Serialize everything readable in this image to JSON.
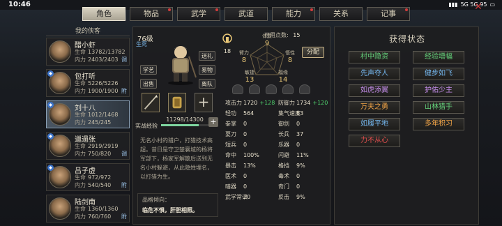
{
  "status_bar": {
    "time": "10:46",
    "indicators": "5G 5G 95"
  },
  "tabs": [
    {
      "label": "角色",
      "active": true,
      "dot": false
    },
    {
      "label": "物品",
      "active": false,
      "dot": true
    },
    {
      "label": "武学",
      "active": false,
      "dot": true
    },
    {
      "label": "武道",
      "active": false,
      "dot": false
    },
    {
      "label": "能力",
      "active": false,
      "dot": true
    },
    {
      "label": "关系",
      "active": false,
      "dot": false
    },
    {
      "label": "记事",
      "active": false,
      "dot": true
    }
  ],
  "left": {
    "header": "我的侠客",
    "characters": [
      {
        "name": "醋小虾",
        "hp": "13782/13782",
        "mp": "2403/2403",
        "tag": "调",
        "selected": false,
        "badge": false
      },
      {
        "name": "包打听",
        "hp": "5226/5226",
        "mp": "1900/1900",
        "tag": "附",
        "selected": false,
        "badge": true
      },
      {
        "name": "刘十八",
        "hp": "1012/1468",
        "mp": "245/245",
        "tag": "",
        "selected": true,
        "badge": true
      },
      {
        "name": "邋遢张",
        "hp": "2919/2919",
        "mp": "750/820",
        "tag": "调",
        "selected": false,
        "badge": true
      },
      {
        "name": "吕子虚",
        "hp": "972/972",
        "mp": "540/540",
        "tag": "附",
        "selected": false,
        "badge": true
      },
      {
        "name": "陆剑南",
        "hp": "1360/1360",
        "mp": "760/760",
        "tag": "附",
        "selected": false,
        "badge": false
      }
    ],
    "hp_label": "生命",
    "mp_label": "内力"
  },
  "center": {
    "level": "76级",
    "alive": "生死",
    "buttons": {
      "skill": "学艺",
      "sell": "出售",
      "send": "送礼",
      "exchange": "易物",
      "leave": "离队"
    },
    "exp_label": "实战经验",
    "exp_value": "11298/14300",
    "exp_progress": 0.79,
    "description": "无名小村的猎户，打猎技术高超。昔日是守卫楚襄城的杨将军部下，杨家军解散后送到无名小村躲避，从此隐姓埋名，以打猎为生。",
    "personality_title": "品格倾向：",
    "personality_value": "临危不惧，肝胆相照。",
    "potential": "18",
    "avail_label": "可用点数:",
    "avail_value": "15",
    "attributes": {
      "tizhi": {
        "label": "体质",
        "value": "9"
      },
      "biili": {
        "label": "臂力",
        "value": "8"
      },
      "wuxing": {
        "label": "悟性",
        "value": "8"
      },
      "minjie": {
        "label": "敏捷",
        "value": "13"
      },
      "fuyuan": {
        "label": "福缘",
        "value": "14"
      }
    },
    "distribute": "分配",
    "stats_left": [
      {
        "k": "攻击力",
        "v": "1720",
        "g": "+128"
      },
      {
        "k": "轻功",
        "v": "564",
        "g": ""
      },
      {
        "k": "拳掌",
        "v": "0",
        "g": ""
      },
      {
        "k": "耍刀",
        "v": "0",
        "g": ""
      },
      {
        "k": "短兵",
        "v": "0",
        "g": ""
      },
      {
        "k": "命中",
        "v": "100%",
        "g": ""
      },
      {
        "k": "暴击",
        "v": "13%",
        "g": ""
      },
      {
        "k": "医术",
        "v": "0",
        "g": ""
      },
      {
        "k": "暗器",
        "v": "0",
        "g": ""
      },
      {
        "k": "武学常识",
        "v": "20",
        "g": ""
      }
    ],
    "stats_right": [
      {
        "k": "防御力",
        "v": "1734",
        "g": "+120"
      },
      {
        "k": "集气速度",
        "v": "63",
        "g": ""
      },
      {
        "k": "御剑",
        "v": "0",
        "g": ""
      },
      {
        "k": "长兵",
        "v": "37",
        "g": ""
      },
      {
        "k": "乐器",
        "v": "0",
        "g": ""
      },
      {
        "k": "闪避",
        "v": "11%",
        "g": ""
      },
      {
        "k": "格挡",
        "v": "9%",
        "g": ""
      },
      {
        "k": "毒术",
        "v": "0",
        "g": ""
      },
      {
        "k": "奇门",
        "v": "0",
        "g": ""
      },
      {
        "k": "反击",
        "v": "9%",
        "g": ""
      }
    ]
  },
  "right": {
    "title": "获得状态",
    "items": [
      {
        "label": "村中隐资",
        "color": "green"
      },
      {
        "label": "经验增幅",
        "color": "green"
      },
      {
        "label": "先声夺人",
        "color": "blue"
      },
      {
        "label": "健步如飞",
        "color": "blue"
      },
      {
        "label": "如虎添翼",
        "color": "purple"
      },
      {
        "label": "护佑少主",
        "color": "purple"
      },
      {
        "label": "万夫之勇",
        "color": "orange"
      },
      {
        "label": "山林猎手",
        "color": "green"
      },
      {
        "label": "如履平地",
        "color": "blue"
      },
      {
        "label": "多年积习",
        "color": "orange"
      },
      {
        "label": "力不从心",
        "color": "red"
      }
    ]
  },
  "colors": {
    "accent": "#e9c777",
    "gain": "#4fd06c"
  }
}
